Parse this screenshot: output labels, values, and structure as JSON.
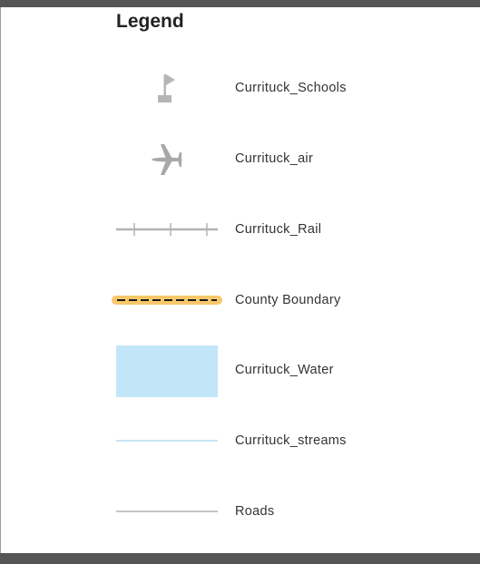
{
  "legend": {
    "title": "Legend",
    "items": [
      {
        "label": "Currituck_Schools",
        "symbol": "school-flag-icon",
        "color": "#b5b5b5"
      },
      {
        "label": "Currituck_air",
        "symbol": "airplane-icon",
        "color": "#a8a8a8"
      },
      {
        "label": "Currituck_Rail",
        "symbol": "rail-line",
        "color": "#b3b3b3"
      },
      {
        "label": "County Boundary",
        "symbol": "dashed-boundary-line",
        "color": "#1a1a1a",
        "halo_color": "#f7c76a"
      },
      {
        "label": "Currituck_Water",
        "symbol": "water-fill",
        "color": "#c2e6f8"
      },
      {
        "label": "Currituck_streams",
        "symbol": "stream-line",
        "color": "#a9d8f0"
      },
      {
        "label": "Roads",
        "symbol": "road-line",
        "color": "#a0a0a0"
      }
    ]
  },
  "frame": {
    "border_color": "#555555"
  }
}
